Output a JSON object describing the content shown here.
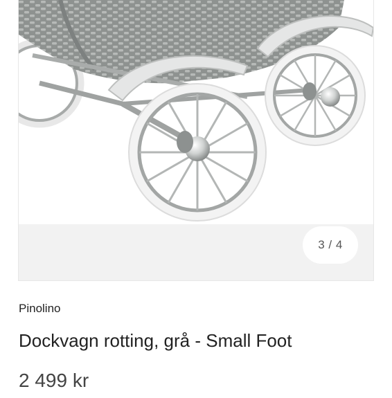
{
  "gallery": {
    "image_alt": "Dockvagn rotting, grå - Small Foot",
    "counter": "3 / 4"
  },
  "product": {
    "brand": "Pinolino",
    "title": "Dockvagn rotting, grå - Small Foot",
    "price": "2 499 kr"
  },
  "colors": {
    "wicker": "#9a9e9c",
    "frame": "#a6a8a7",
    "tire": "#f4f4f4",
    "background": "#f2f2f2"
  }
}
